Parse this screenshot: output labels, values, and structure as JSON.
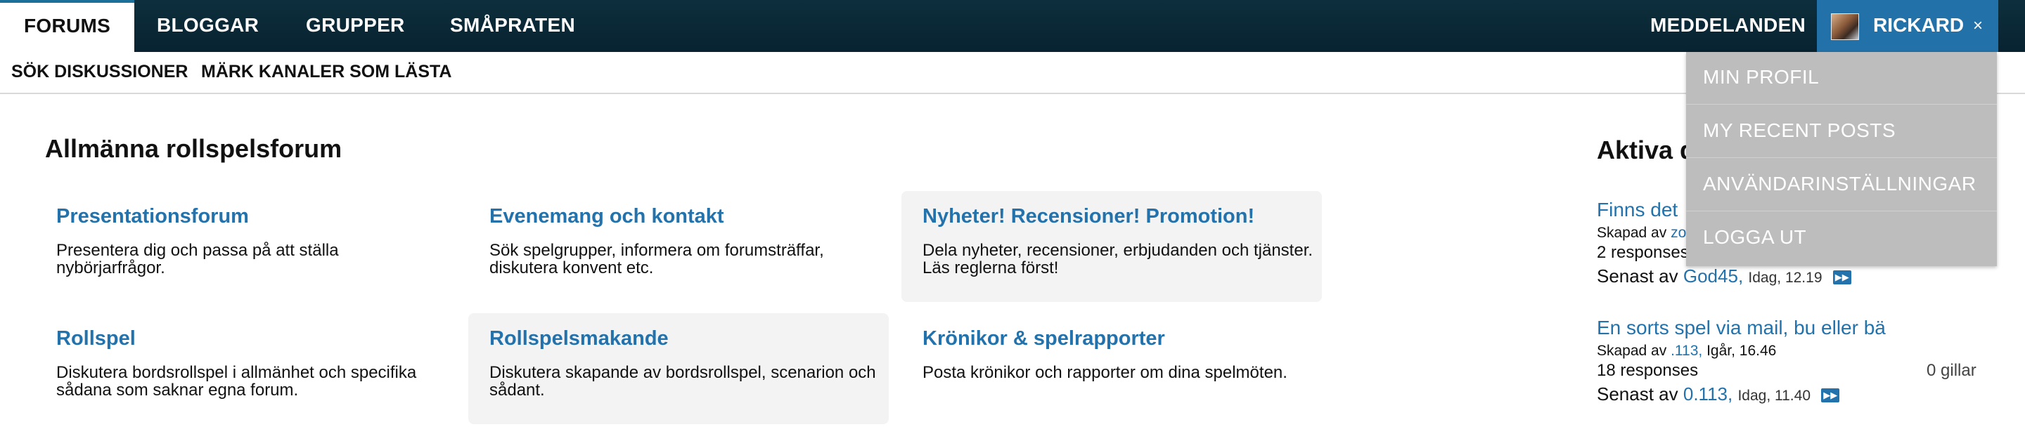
{
  "nav": {
    "tabs": [
      {
        "label": "FORUMS"
      },
      {
        "label": "BLOGGAR"
      },
      {
        "label": "GRUPPER"
      },
      {
        "label": "SMÅPRATEN"
      }
    ],
    "messages_label": "MEDDELANDEN",
    "user": {
      "name": "RICKARD",
      "close_glyph": "×"
    }
  },
  "subnav": {
    "search_label": "SÖK DISKUSSIONER",
    "mark_read_label": "MÄRK KANALER SOM LÄSTA"
  },
  "user_menu": {
    "items": [
      {
        "label": "MIN PROFIL"
      },
      {
        "label": "MY RECENT POSTS"
      },
      {
        "label": "ANVÄNDARINSTÄLLNINGAR"
      },
      {
        "label": "LOGGA UT"
      }
    ]
  },
  "main": {
    "section_title": "Allmänna rollspelsforum",
    "forums": [
      {
        "title": "Presentationsforum",
        "description": "Presentera dig och passa på att ställa nybörjarfrågor."
      },
      {
        "title": "Evenemang och kontakt",
        "description": "Sök spelgrupper, informera om forumsträffar, diskutera konvent etc."
      },
      {
        "title": "Nyheter! Recensioner! Promotion!",
        "description": "Dela nyheter, recensioner, erbjudanden och tjänster. Läs reglerna först!"
      },
      {
        "title": "Rollspel",
        "description": "Diskutera bordsrollspel i allmänhet och specifika sådana som saknar egna forum."
      },
      {
        "title": "Rollspelsmakande",
        "description": "Diskutera skapande av bordsrollspel, scenarion och sådant."
      },
      {
        "title": "Krönikor & spelrapporter",
        "description": "Posta krönikor och rapporter om dina spelmöten."
      }
    ]
  },
  "sidebar": {
    "title": "Aktiva d",
    "topics": [
      {
        "title": "Finns det",
        "created_prefix": "Skapad av",
        "created_by": "zo",
        "created_when": "",
        "responses": "2 responses",
        "likes": "",
        "last_prefix": "Senast av",
        "last_by": "God45,",
        "last_when": "Idag, 12.19"
      },
      {
        "title": "En sorts spel via mail, bu eller bä",
        "created_prefix": "Skapad av",
        "created_by": ".113,",
        "created_when": "Igår, 16.46",
        "responses": "18 responses",
        "likes": "0 gillar",
        "last_prefix": "Senast av",
        "last_by": "0.113,",
        "last_when": "Idag, 11.40"
      }
    ]
  },
  "colors": {
    "topbar": "#0a2836",
    "accent_blue": "#2372ac",
    "user_tab": "#2272a9",
    "dropdown": "#bdbdbd"
  },
  "icons": {
    "go_to_post": "double-arrow-right-icon",
    "close": "close-icon"
  }
}
